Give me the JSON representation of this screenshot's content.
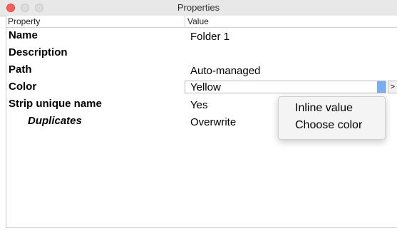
{
  "window": {
    "title": "Properties"
  },
  "table": {
    "headers": {
      "property": "Property",
      "value": "Value"
    },
    "rows": [
      {
        "name": "Name",
        "value": "Folder 1"
      },
      {
        "name": "Description",
        "value": ""
      },
      {
        "name": "Path",
        "value": "Auto-managed"
      },
      {
        "name": "Color",
        "value": "Yellow"
      },
      {
        "name": "Strip unique name",
        "value": "Yes"
      },
      {
        "name": "Duplicates",
        "value": "Overwrite"
      }
    ],
    "editor_button": ">"
  },
  "context_menu": {
    "items": [
      "Inline value",
      "Choose color"
    ]
  },
  "colors": {
    "close": "#fe5f57",
    "focus_accent": "#7aaef3"
  },
  "icons": {
    "close": "close-traffic-light",
    "minimize": "minimize-traffic-light",
    "maximize": "maximize-traffic-light"
  }
}
